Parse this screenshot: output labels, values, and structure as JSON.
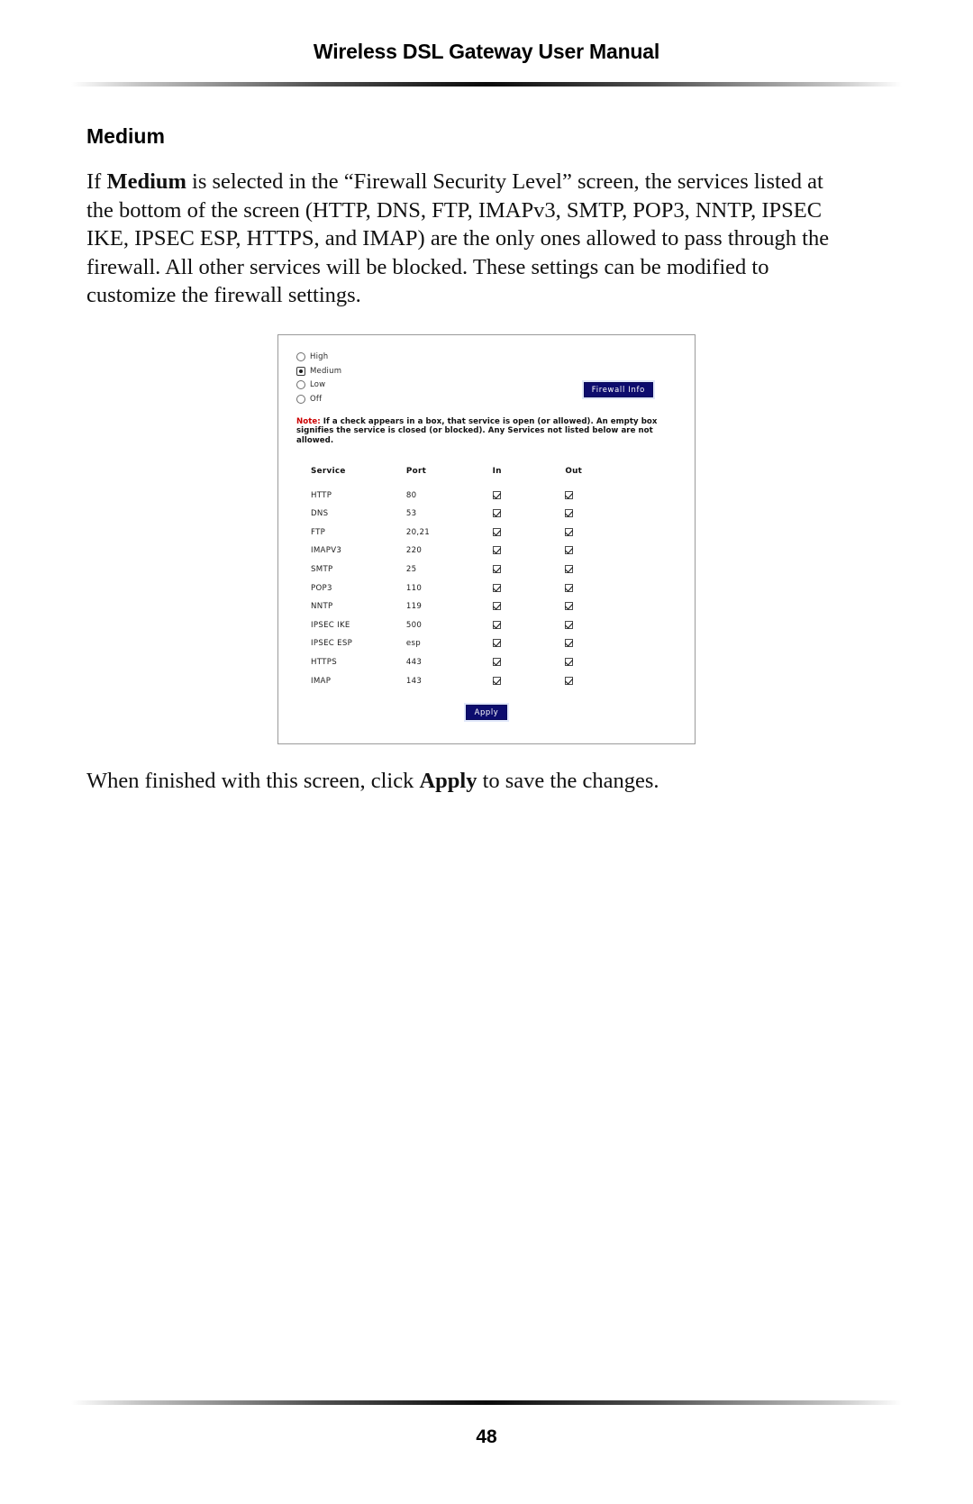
{
  "header": {
    "title": "Wireless DSL Gateway User Manual"
  },
  "section": {
    "heading": "Medium",
    "paragraph_lead": "If ",
    "paragraph_bold": "Medium",
    "paragraph_rest": " is selected in the “Firewall Security Level” screen, the services listed at the bottom of the screen (HTTP, DNS, FTP, IMAPv3, SMTP, POP3, NNTP, IPSEC IKE, IPSEC ESP, HTTPS, and IMAP) are the only ones allowed to pass through the firewall. All other services will be blocked. These settings can be modified to customize the firewall settings."
  },
  "screenshot": {
    "security_levels": [
      {
        "label": "High",
        "selected": false
      },
      {
        "label": "Medium",
        "selected": true
      },
      {
        "label": "Low",
        "selected": false
      },
      {
        "label": "Off",
        "selected": false
      }
    ],
    "firewall_info_button": "Firewall Info",
    "note": {
      "label": "Note:",
      "text": " If a check appears in a box, that service is open (or allowed). An empty box signifies the service is closed (or blocked). Any Services not listed below are not allowed."
    },
    "table": {
      "columns": [
        "Service",
        "Port",
        "In",
        "Out"
      ],
      "rows": [
        {
          "service": "HTTP",
          "port": "80",
          "in": true,
          "out": true
        },
        {
          "service": "DNS",
          "port": "53",
          "in": true,
          "out": true
        },
        {
          "service": "FTP",
          "port": "20,21",
          "in": true,
          "out": true
        },
        {
          "service": "IMAPV3",
          "port": "220",
          "in": true,
          "out": true
        },
        {
          "service": "SMTP",
          "port": "25",
          "in": true,
          "out": true
        },
        {
          "service": "POP3",
          "port": "110",
          "in": true,
          "out": true
        },
        {
          "service": "NNTP",
          "port": "119",
          "in": true,
          "out": true
        },
        {
          "service": "IPSEC IKE",
          "port": "500",
          "in": true,
          "out": true
        },
        {
          "service": "IPSEC ESP",
          "port": "esp",
          "in": true,
          "out": true
        },
        {
          "service": "HTTPS",
          "port": "443",
          "in": true,
          "out": true
        },
        {
          "service": "IMAP",
          "port": "143",
          "in": true,
          "out": true
        }
      ]
    },
    "apply_button": "Apply"
  },
  "closing": {
    "lead": "When finished with this screen, click ",
    "bold": "Apply",
    "rest": " to save the changes."
  },
  "footer": {
    "page_number": "48"
  },
  "colors": {
    "button_blue": "#0c0c6e",
    "note_red": "#cc0000",
    "text_black": "#000000"
  }
}
